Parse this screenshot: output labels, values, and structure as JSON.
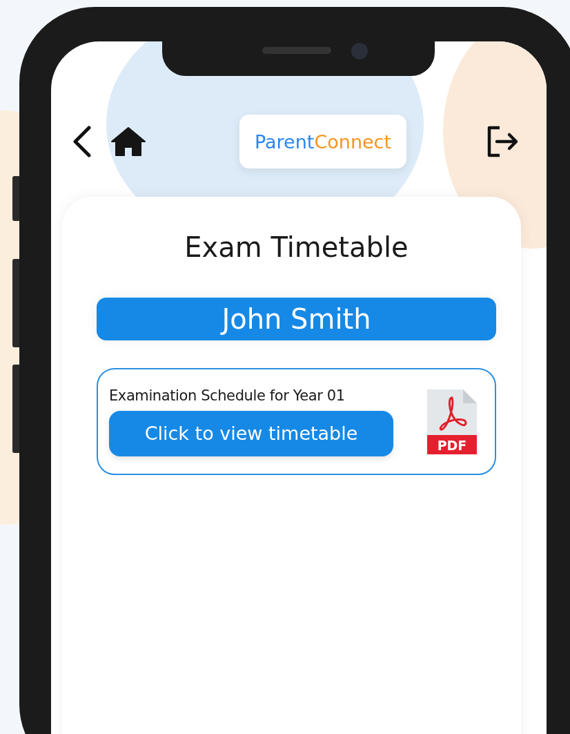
{
  "header": {
    "brand": {
      "first": "Parent",
      "second": "Connect"
    }
  },
  "page": {
    "title": "Exam Timetable",
    "student_name": "John Smith"
  },
  "documents": [
    {
      "title": "Examination Schedule for Year 01",
      "button": "Click to view timetable",
      "file_label": "PDF"
    }
  ]
}
